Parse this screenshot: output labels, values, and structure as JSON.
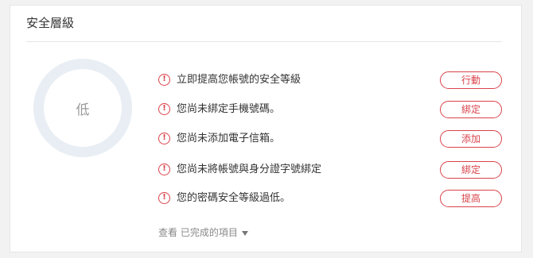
{
  "card": {
    "title": "安全層級"
  },
  "level": {
    "label": "低"
  },
  "items": [
    {
      "text": "立即提高您帳號的安全等級",
      "action": "行動"
    },
    {
      "text": "您尚未綁定手機號碼。",
      "action": "綁定"
    },
    {
      "text": "您尚未添加電子信箱。",
      "action": "添加"
    },
    {
      "text": "您尚未將帳號與身分證字號綁定",
      "action": "綁定"
    },
    {
      "text": "您的密碼安全等級過低。",
      "action": "提高"
    }
  ],
  "footer": {
    "view_completed": "查看 已完成的項目"
  },
  "colors": {
    "alert": "#d9434b",
    "ring": "#e8eef4"
  },
  "icons": {
    "warning": "warning-circle-icon",
    "expand": "caret-down-icon"
  }
}
